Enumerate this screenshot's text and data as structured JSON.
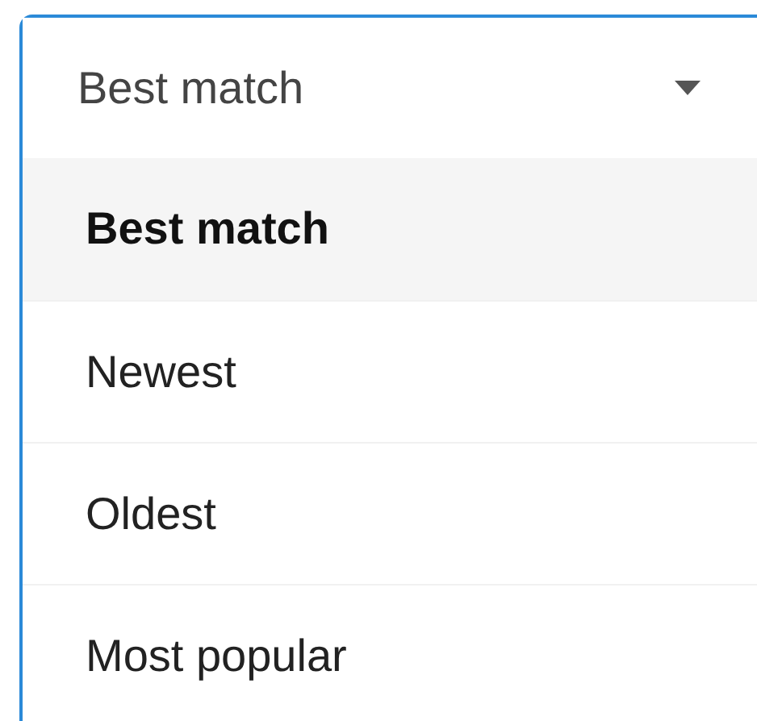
{
  "dropdown": {
    "value": "Best match",
    "expanded": true,
    "options": [
      {
        "label": "Best match",
        "selected": true
      },
      {
        "label": "Newest",
        "selected": false
      },
      {
        "label": "Oldest",
        "selected": false
      },
      {
        "label": "Most popular",
        "selected": false
      }
    ]
  }
}
